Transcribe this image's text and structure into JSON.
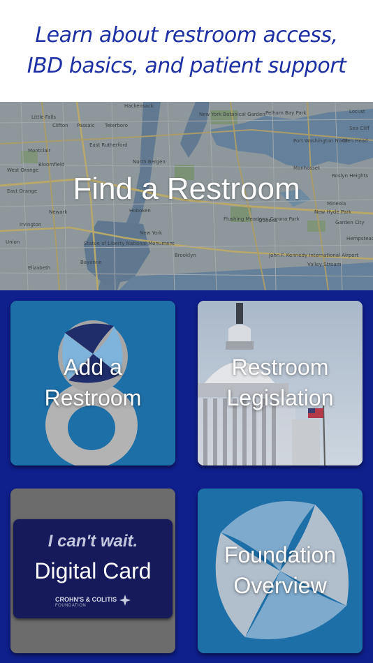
{
  "header": {
    "line1": "Learn about restroom access,",
    "line2": "IBD basics, and patient support"
  },
  "find_restroom": {
    "label": "Find a Restroom",
    "map_labels": [
      "Hackensack",
      "Little Falls",
      "Clifton",
      "Passaic",
      "Teterboro",
      "New York Botanical Garden",
      "Pelham Bay Park",
      "Montclair",
      "East Rutherford",
      "Bloomfield",
      "North Bergen",
      "West Orange",
      "East Orange",
      "Newark",
      "Hoboken",
      "New York",
      "Flushing Meadows Corona Park",
      "Queens",
      "Irvington",
      "Union",
      "Statue of Liberty National Monument",
      "Brooklyn",
      "Bayonne",
      "Elizabeth",
      "John F. Kennedy International Airport",
      "Valley Stream",
      "Manhasset",
      "Roslyn Heights",
      "Mineola",
      "New Hyde Park",
      "Garden City",
      "Hempstead",
      "Glen Head",
      "Locust",
      "Sea Cliff",
      "Port Washington North"
    ]
  },
  "tiles": {
    "add_restroom": {
      "line1": "Add a",
      "line2": "Restroom"
    },
    "restroom_legislation": {
      "line1": "Restroom",
      "line2": "Legislation"
    },
    "digital_card": {
      "quote": "I can't wait.",
      "title": "Digital Card",
      "logo_text": "CROHN'S & COLITIS",
      "logo_sub": "FOUNDATION"
    },
    "foundation_overview": {
      "line1": "Foundation",
      "line2": "Overview"
    }
  },
  "colors": {
    "header_text": "#1c2fa3",
    "grid_background": "#0f1f8c",
    "tile_blue": "#1d6fa8",
    "card_navy": "#16195a"
  }
}
